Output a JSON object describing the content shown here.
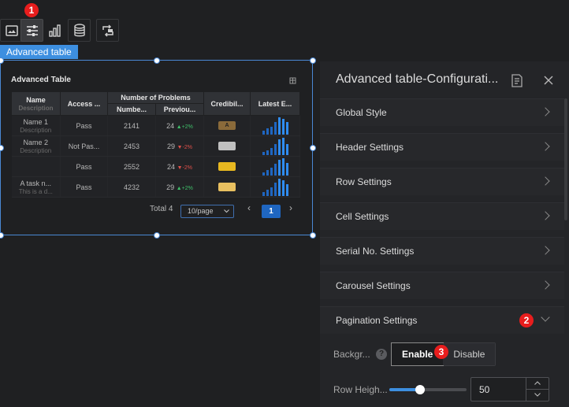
{
  "toolbar": {
    "badge1": "1",
    "buttons": [
      "image-icon",
      "sliders-icon",
      "bar-chart-icon",
      "database-icon",
      "swap-icon"
    ]
  },
  "component_tag": "Advanced table",
  "widget": {
    "title": "Advanced Table",
    "columns": {
      "name": {
        "label": "Name",
        "sub": "Description"
      },
      "access": "Access ...",
      "problems_group": "Number of Problems",
      "problems_num": "Numbe...",
      "problems_prev": "Previou...",
      "cred": "Credibil...",
      "latest": "Latest E..."
    },
    "rows": [
      {
        "name": "Name 1",
        "desc": "Description",
        "access": "Pass",
        "num": "2141",
        "prev": "24",
        "pct": "+2%",
        "dir": "up",
        "cred_color": "#8a6a3a",
        "cred_text": "A"
      },
      {
        "name": "Name 2",
        "desc": "Description",
        "access": "Not Pas...",
        "num": "2453",
        "prev": "29",
        "pct": "-2%",
        "dir": "dn",
        "cred_color": "#c0c0c0",
        "cred_text": ""
      },
      {
        "name": "",
        "desc": "",
        "access": "Pass",
        "num": "2552",
        "prev": "24",
        "pct": "-2%",
        "dir": "dn",
        "cred_color": "#e8b820",
        "cred_text": ""
      },
      {
        "name": "A task n...",
        "desc": "This is a d...",
        "access": "Pass",
        "num": "4232",
        "prev": "29",
        "pct": "+2%",
        "dir": "up",
        "cred_color": "#e8c060",
        "cred_text": ""
      }
    ],
    "pagination": {
      "total": "Total 4",
      "page_size": "10/page",
      "prev": "‹",
      "page": "1",
      "next": "›"
    }
  },
  "panel": {
    "title": "Advanced table-Configurati...",
    "sections": [
      {
        "label": "Global Style"
      },
      {
        "label": "Header Settings"
      },
      {
        "label": "Row Settings"
      },
      {
        "label": "Cell Settings"
      },
      {
        "label": "Serial No. Settings"
      },
      {
        "label": "Carousel Settings"
      },
      {
        "label": "Pagination Settings",
        "badge": "2",
        "expanded": true
      }
    ],
    "background": {
      "label": "Backgr...",
      "enable": "Enable",
      "disable": "Disable",
      "badge": "3"
    },
    "row_height": {
      "label": "Row Heigh...",
      "value": "50",
      "slider_fraction": 0.4
    }
  }
}
